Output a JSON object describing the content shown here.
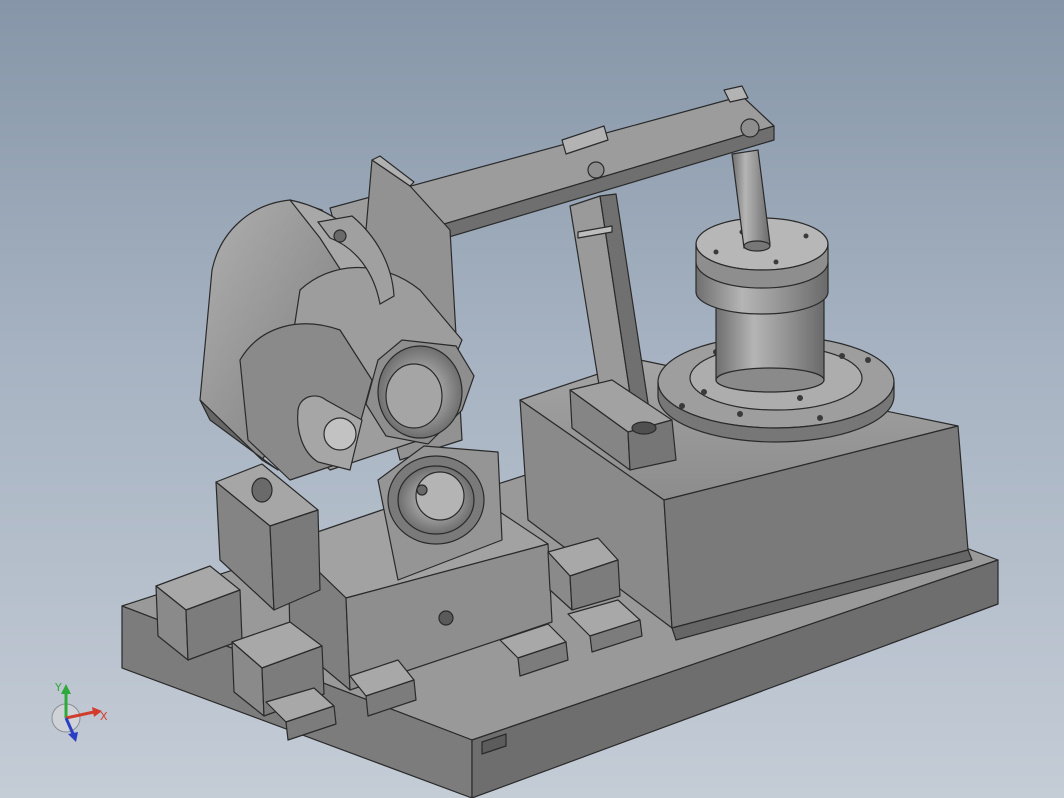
{
  "viewport": {
    "background_top": "#8696a8",
    "background_bottom": "#c4ccd6",
    "model_color": "#8f8f8f"
  },
  "triad": {
    "x_label": "X",
    "y_label": "Y",
    "x_color": "#d23c2c",
    "y_color": "#2eaa3c",
    "z_color": "#2b3fc4"
  }
}
